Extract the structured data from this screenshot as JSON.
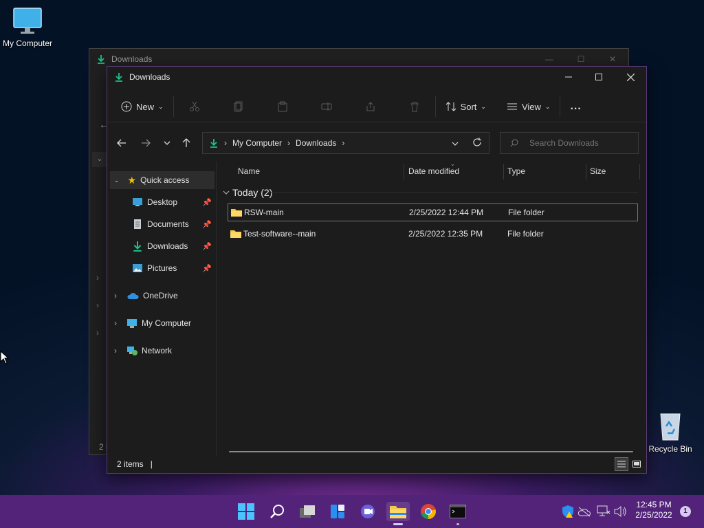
{
  "desktop": {
    "icons": [
      {
        "name": "my-computer",
        "label": "My Computer"
      },
      {
        "name": "recycle-bin",
        "label": "Recycle Bin"
      }
    ]
  },
  "back_window": {
    "title": "Downloads",
    "status_partial": "2 i"
  },
  "window": {
    "title": "Downloads",
    "toolbar": {
      "new_label": "New",
      "sort_label": "Sort",
      "view_label": "View",
      "more_label": "..."
    },
    "address": {
      "crumbs": [
        "My Computer",
        "Downloads"
      ]
    },
    "search": {
      "placeholder": "Search Downloads"
    },
    "nav": {
      "quick_access": "Quick access",
      "pinned": [
        {
          "label": "Desktop",
          "icon": "desktop-icon"
        },
        {
          "label": "Documents",
          "icon": "documents-icon"
        },
        {
          "label": "Downloads",
          "icon": "downloads-icon"
        },
        {
          "label": "Pictures",
          "icon": "pictures-icon"
        }
      ],
      "roots": [
        {
          "label": "OneDrive",
          "icon": "cloud-icon"
        },
        {
          "label": "My Computer",
          "icon": "computer-icon"
        },
        {
          "label": "Network",
          "icon": "network-icon"
        }
      ]
    },
    "columns": {
      "name": "Name",
      "date": "Date modified",
      "type": "Type",
      "size": "Size"
    },
    "group": {
      "label": "Today (2)"
    },
    "files": [
      {
        "name": "RSW-main",
        "date": "2/25/2022 12:44 PM",
        "type": "File folder",
        "size": ""
      },
      {
        "name": "Test-software--main",
        "date": "2/25/2022 12:35 PM",
        "type": "File folder",
        "size": ""
      }
    ],
    "status": {
      "count": "2 items",
      "separator": "|"
    }
  },
  "taskbar": {
    "time": "12:45 PM",
    "date": "2/25/2022",
    "notifications": "1",
    "colors": {
      "bar": "#53237a",
      "accent": "#4cc2ff"
    }
  }
}
